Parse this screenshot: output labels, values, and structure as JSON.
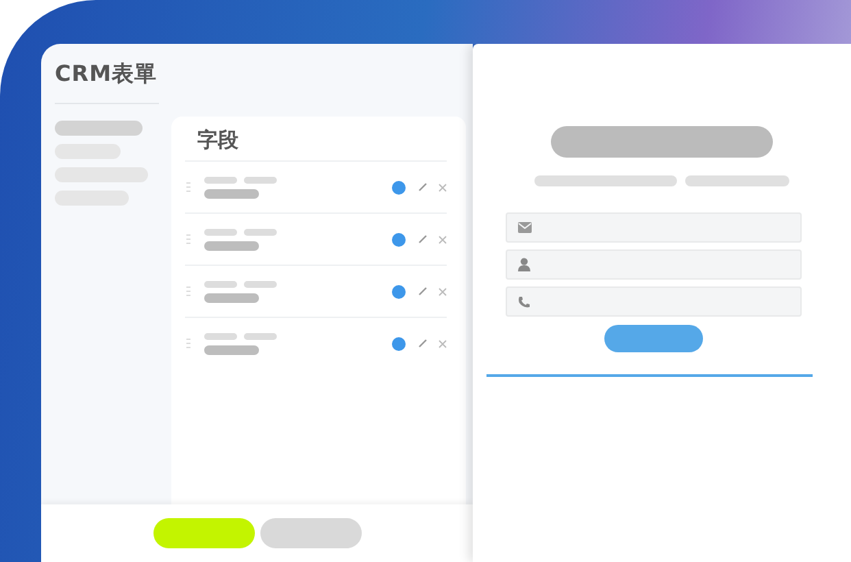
{
  "app": {
    "title": "CRM表單"
  },
  "sidebar": {
    "items": [
      {
        "kind": "item",
        "selected": true
      },
      {
        "kind": "item",
        "selected": false
      },
      {
        "kind": "item",
        "selected": false
      },
      {
        "kind": "item",
        "selected": false
      }
    ]
  },
  "fields_panel": {
    "title": "字段",
    "rows": [
      {
        "kind": "field"
      },
      {
        "kind": "field"
      },
      {
        "kind": "field"
      },
      {
        "kind": "field"
      }
    ]
  },
  "form_preview": {
    "inputs": [
      {
        "kind": "email"
      },
      {
        "kind": "name"
      },
      {
        "kind": "phone"
      }
    ]
  }
}
